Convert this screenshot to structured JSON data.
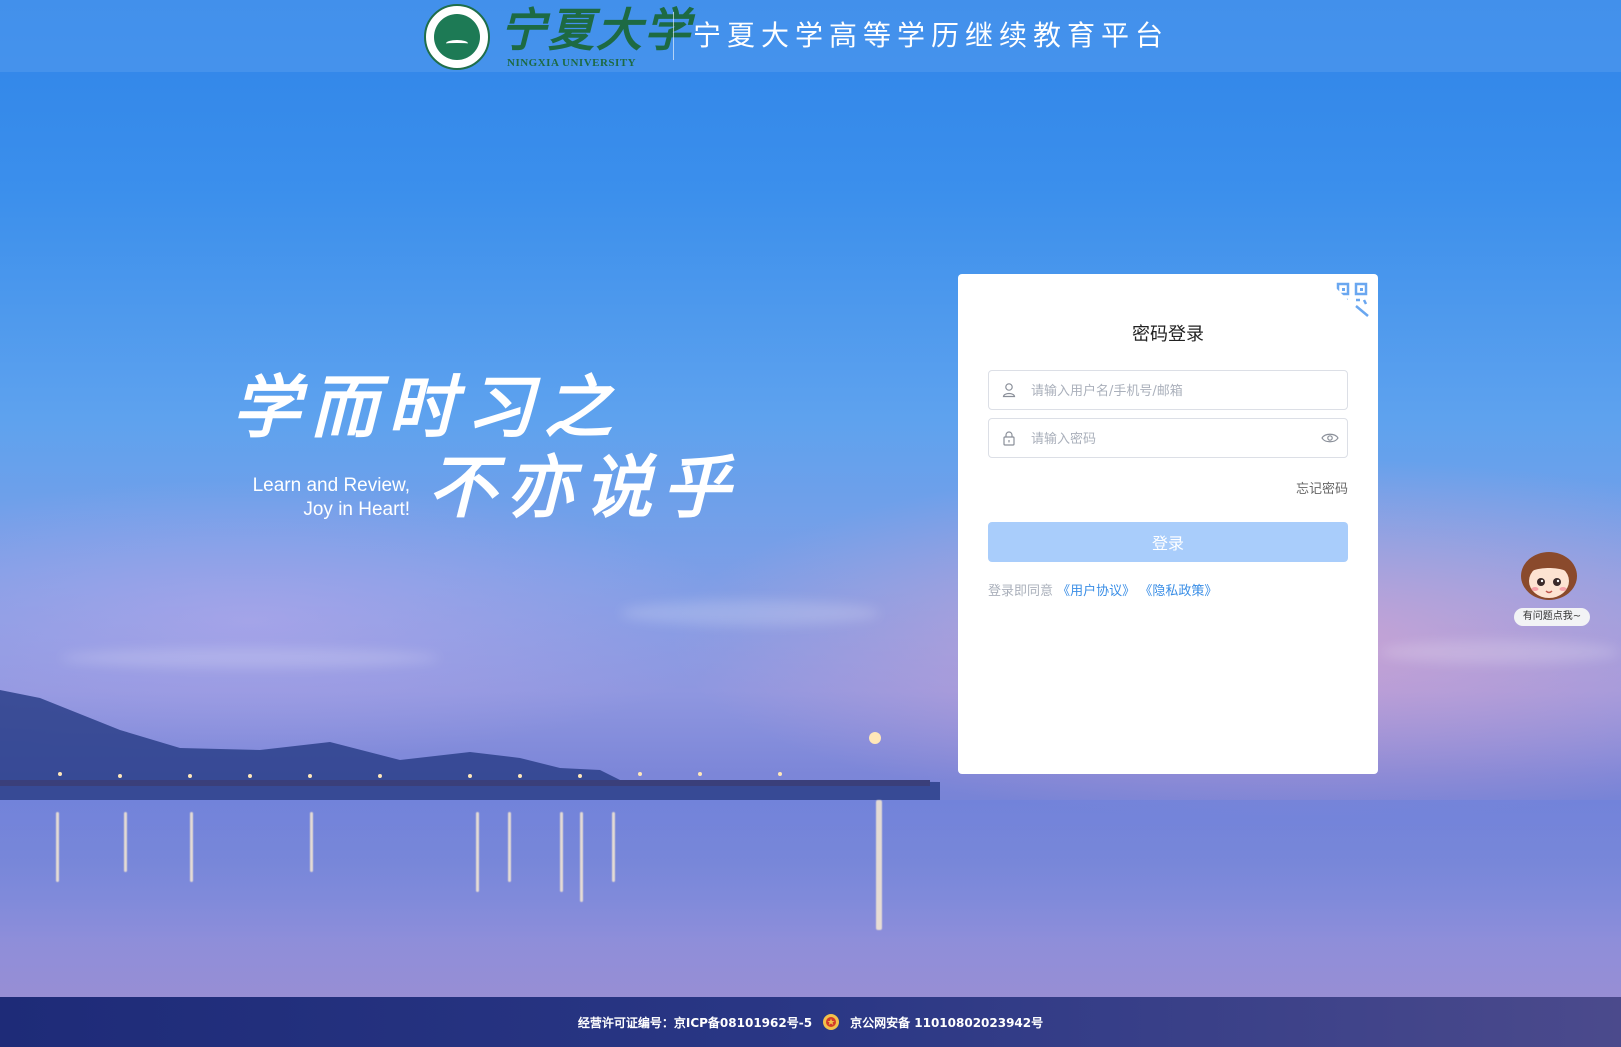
{
  "header": {
    "logo_cn": "宁夏大学",
    "logo_en": "NINGXIA UNIVERSITY",
    "platform_title": "宁夏大学高等学历继续教育平台"
  },
  "slogan": {
    "cn_line1": "学而时习之",
    "cn_line2": "不亦说乎",
    "en_line1": "Learn and Review,",
    "en_line2": "Joy in Heart!"
  },
  "login": {
    "title": "密码登录",
    "username_placeholder": "请输入用户名/手机号/邮箱",
    "password_placeholder": "请输入密码",
    "forgot_label": "忘记密码",
    "submit_label": "登录",
    "agree_prefix": "登录即同意",
    "user_agreement": "《用户协议》",
    "privacy_policy": "《隐私政策》",
    "qr_icon": "qr-code-icon"
  },
  "assistant": {
    "bubble_text": "有问题点我~"
  },
  "footer": {
    "icp": "经营许可证编号：京ICP备08101962号-5",
    "police": "京公网安备 11010802023942号"
  },
  "colors": {
    "primary": "#3a8ee6",
    "button_disabled": "#a9cdfb",
    "logo_green": "#1d6a43"
  }
}
